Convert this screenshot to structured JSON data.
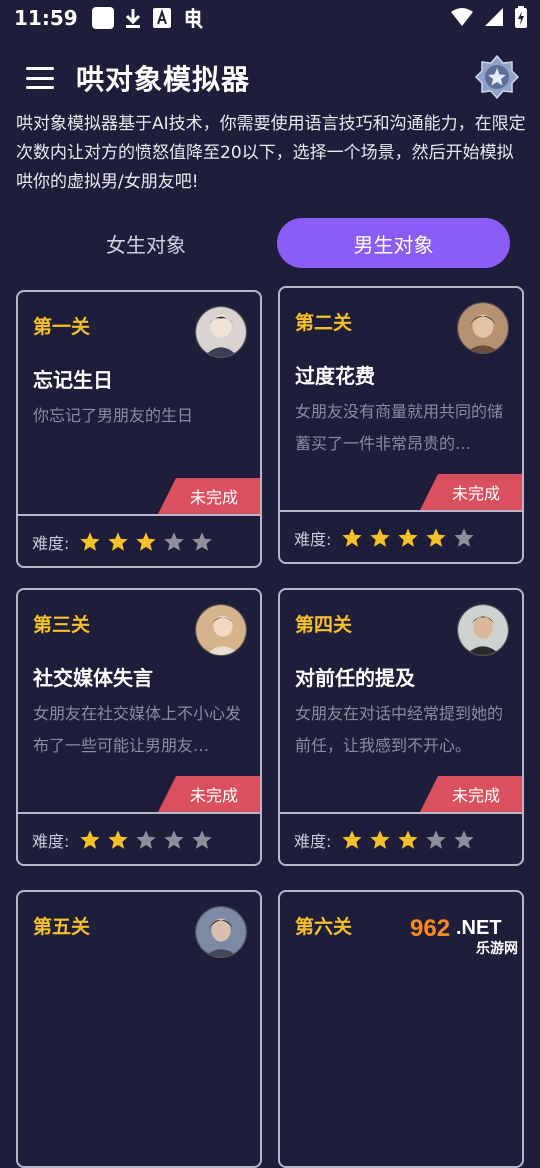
{
  "status": {
    "time": "11:59"
  },
  "header": {
    "title": "哄对象模拟器"
  },
  "intro": "哄对象模拟器基于AI技术，你需要使用语言技巧和沟通能力，在限定次数内让对方的愤怒值降至20以下，选择一个场景，然后开始模拟哄你的虚拟男/女朋友吧!",
  "tabs": [
    {
      "label": "女生对象",
      "active": false
    },
    {
      "label": "男生对象",
      "active": true
    }
  ],
  "difficulty_label": "难度:",
  "cards": [
    {
      "level": "第一关",
      "title": "忘记生日",
      "desc": "你忘记了男朋友的生日",
      "status": "未完成",
      "stars": 3,
      "avatar": "avatar-1"
    },
    {
      "level": "第二关",
      "title": "过度花费",
      "desc": "女朋友没有商量就用共同的储蓄买了一件非常昂贵的…",
      "status": "未完成",
      "stars": 4,
      "avatar": "avatar-2"
    },
    {
      "level": "第三关",
      "title": "社交媒体失言",
      "desc": "女朋友在社交媒体上不小心发布了一些可能让男朋友…",
      "status": "未完成",
      "stars": 2,
      "avatar": "avatar-3"
    },
    {
      "level": "第四关",
      "title": "对前任的提及",
      "desc": "女朋友在对话中经常提到她的前任，让我感到不开心。",
      "status": "未完成",
      "stars": 3,
      "avatar": "avatar-4"
    },
    {
      "level": "第五关",
      "title": "",
      "desc": "",
      "status": "",
      "stars": 0,
      "avatar": "avatar-5"
    },
    {
      "level": "第六关",
      "title": "",
      "desc": "",
      "status": "",
      "stars": 0,
      "avatar": "avatar-6"
    }
  ],
  "colors": {
    "background": "#1e1d3a",
    "accent": "#8b5cf6",
    "level": "#f5c02a",
    "ribbon": "#d9505f",
    "star_on": "#f5c02a",
    "star_off": "#8f8f9c"
  },
  "watermark": {
    "text1": "962",
    "text2": ".NET",
    "text3": "乐游网"
  }
}
